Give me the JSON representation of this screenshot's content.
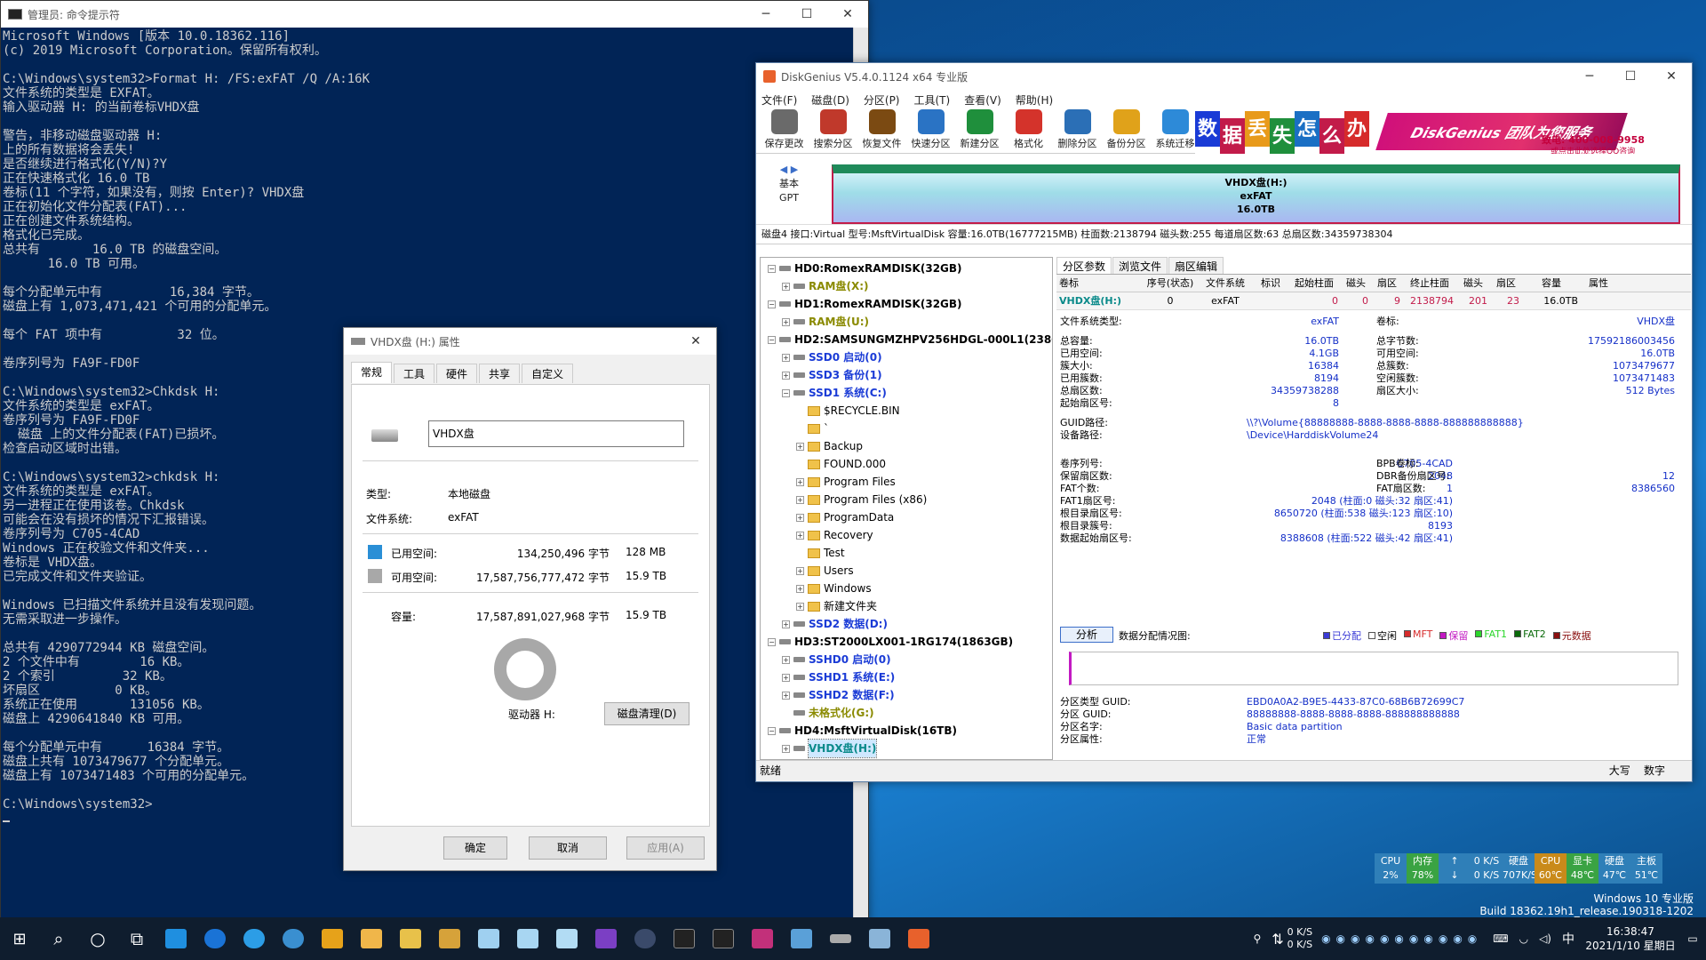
{
  "cmd": {
    "title": "管理员: 命令提示符",
    "lines": [
      "Microsoft Windows [版本 10.0.18362.116]",
      "(c) 2019 Microsoft Corporation。保留所有权利。",
      "",
      "C:\\Windows\\system32>Format H: /FS:exFAT /Q /A:16K",
      "文件系统的类型是 EXFAT。",
      "输入驱动器 H: 的当前卷标VHDX盘",
      "",
      "警告，非移动磁盘驱动器 H:",
      "上的所有数据将会丢失!",
      "是否继续进行格式化(Y/N)?Y",
      "正在快速格式化 16.0 TB",
      "卷标(11 个字符，如果没有，则按 Enter)? VHDX盘",
      "正在初始化文件分配表(FAT)...",
      "正在创建文件系统结构。",
      "格式化已完成。",
      "总共有       16.0 TB 的磁盘空间。",
      "      16.0 TB 可用。",
      "",
      "每个分配单元中有         16,384 字节。",
      "磁盘上有 1,073,471,421 个可用的分配单元。",
      "",
      "每个 FAT 项中有          32 位。",
      "",
      "卷序列号为 FA9F-FD0F",
      "",
      "C:\\Windows\\system32>Chkdsk H:",
      "文件系统的类型是 exFAT。",
      "卷序列号为 FA9F-FD0F",
      "  磁盘 上的文件分配表(FAT)已损坏。",
      "检查启动区域时出错。",
      "",
      "C:\\Windows\\system32>chkdsk H:",
      "文件系统的类型是 exFAT。",
      "另一进程正在使用该卷。Chkdsk",
      "可能会在没有损坏的情况下汇报错误。",
      "卷序列号为 C705-4CAD",
      "Windows 正在校验文件和文件夹...",
      "卷标是 VHDX盘。",
      "已完成文件和文件夹验证。",
      "",
      "Windows 已扫描文件系统并且没有发现问题。",
      "无需采取进一步操作。",
      "",
      "总共有 4290772944 KB 磁盘空间。",
      "2 个文件中有        16 KB。",
      "2 个索引         32 KB。",
      "坏扇区          0 KB。",
      "系统正在使用       131056 KB。",
      "磁盘上 4290641840 KB 可用。",
      "",
      "每个分配单元中有      16384 字节。",
      "磁盘上共有 1073479677 个分配单元。",
      "磁盘上有 1073471483 个可用的分配单元。",
      "",
      "C:\\Windows\\system32>"
    ]
  },
  "dg": {
    "title": "DiskGenius V5.4.0.1124 x64 专业版",
    "menu": [
      "文件(F)",
      "磁盘(D)",
      "分区(P)",
      "工具(T)",
      "查看(V)",
      "帮助(H)"
    ],
    "tools": [
      {
        "label": "保存更改",
        "color": "#6a6a6a"
      },
      {
        "label": "搜索分区",
        "color": "#c0392b"
      },
      {
        "label": "恢复文件",
        "color": "#7b4a12"
      },
      {
        "label": "快速分区",
        "color": "#2a73c4"
      },
      {
        "label": "新建分区",
        "color": "#1f8f3c"
      },
      {
        "label": "格式化",
        "color": "#d4332b"
      },
      {
        "label": "删除分区",
        "color": "#2b6fb6"
      },
      {
        "label": "备份分区",
        "color": "#e0a21a"
      },
      {
        "label": "系统迁移",
        "color": "#2d8ad8"
      }
    ],
    "ad": {
      "tiles": [
        "数",
        "据",
        "丢",
        "失",
        "怎",
        "么",
        "办"
      ],
      "slogan": "DiskGenius 团队为您服务",
      "phone": "致电: 400-008-9958",
      "qq": "或点击此处选择QQ咨询"
    },
    "diskmap": {
      "basic": "基本",
      "gpt": "GPT",
      "name": "VHDX盘(H:)",
      "fs": "exFAT",
      "size": "16.0TB"
    },
    "diskinfo": "磁盘4 接口:Virtual  型号:MsftVirtualDisk  容量:16.0TB(16777215MB)  柱面数:2138794  磁头数:255  每道扇区数:63  总扇区数:34359738304",
    "tree": [
      {
        "t": "HD0:RomexRAMDISK(32GB)",
        "lvl": 0,
        "box": "⊟",
        "cls": "bold",
        "icon": "dk"
      },
      {
        "t": "RAM盘(X:)",
        "lvl": 1,
        "box": "⊞",
        "cls": "olive",
        "icon": "dk"
      },
      {
        "t": "HD1:RomexRAMDISK(32GB)",
        "lvl": 0,
        "box": "⊟",
        "cls": "bold",
        "icon": "dk"
      },
      {
        "t": "RAM盘(U:)",
        "lvl": 1,
        "box": "⊞",
        "cls": "olive",
        "icon": "dk"
      },
      {
        "t": "HD2:SAMSUNGMZHPV256HDGL-000L1(238GB)",
        "lvl": 0,
        "box": "⊟",
        "cls": "bold",
        "icon": "dk"
      },
      {
        "t": "SSD0 启动(0)",
        "lvl": 1,
        "box": "⊞",
        "cls": "blue",
        "icon": "dk"
      },
      {
        "t": "SSD3 备份(1)",
        "lvl": 1,
        "box": "⊞",
        "cls": "blue",
        "icon": "dk"
      },
      {
        "t": "SSD1 系统(C:)",
        "lvl": 1,
        "box": "⊟",
        "cls": "blue",
        "icon": "dk"
      },
      {
        "t": "$RECYCLE.BIN",
        "lvl": 2,
        "box": "",
        "cls": "",
        "icon": "fd"
      },
      {
        "t": "`",
        "lvl": 2,
        "box": "",
        "cls": "",
        "icon": "fd"
      },
      {
        "t": "Backup",
        "lvl": 2,
        "box": "⊞",
        "cls": "",
        "icon": "fd"
      },
      {
        "t": "FOUND.000",
        "lvl": 2,
        "box": "",
        "cls": "",
        "icon": "fd"
      },
      {
        "t": "Program Files",
        "lvl": 2,
        "box": "⊞",
        "cls": "",
        "icon": "fd"
      },
      {
        "t": "Program Files (x86)",
        "lvl": 2,
        "box": "⊞",
        "cls": "",
        "icon": "fd"
      },
      {
        "t": "ProgramData",
        "lvl": 2,
        "box": "⊞",
        "cls": "",
        "icon": "fd"
      },
      {
        "t": "Recovery",
        "lvl": 2,
        "box": "⊞",
        "cls": "",
        "icon": "fd"
      },
      {
        "t": "Test",
        "lvl": 2,
        "box": "",
        "cls": "",
        "icon": "fd"
      },
      {
        "t": "Users",
        "lvl": 2,
        "box": "⊞",
        "cls": "",
        "icon": "fd"
      },
      {
        "t": "Windows",
        "lvl": 2,
        "box": "⊞",
        "cls": "",
        "icon": "fd"
      },
      {
        "t": "新建文件夹",
        "lvl": 2,
        "box": "⊞",
        "cls": "",
        "icon": "fd"
      },
      {
        "t": "SSD2 数据(D:)",
        "lvl": 1,
        "box": "⊞",
        "cls": "blue",
        "icon": "dk"
      },
      {
        "t": "HD3:ST2000LX001-1RG174(1863GB)",
        "lvl": 0,
        "box": "⊟",
        "cls": "bold",
        "icon": "dk"
      },
      {
        "t": "SSHD0 启动(0)",
        "lvl": 1,
        "box": "⊞",
        "cls": "blue",
        "icon": "dk"
      },
      {
        "t": "SSHD1 系统(E:)",
        "lvl": 1,
        "box": "⊞",
        "cls": "blue",
        "icon": "dk"
      },
      {
        "t": "SSHD2 数据(F:)",
        "lvl": 1,
        "box": "⊞",
        "cls": "blue",
        "icon": "dk"
      },
      {
        "t": "未格式化(G:)",
        "lvl": 1,
        "box": "",
        "cls": "olive",
        "icon": "dk"
      },
      {
        "t": "HD4:MsftVirtualDisk(16TB)",
        "lvl": 0,
        "box": "⊟",
        "cls": "bold",
        "icon": "dk"
      },
      {
        "t": "VHDX盘(H:)",
        "lvl": 1,
        "box": "⊞",
        "cls": "teal sel",
        "icon": "dk"
      }
    ],
    "tabs": [
      "分区参数",
      "浏览文件",
      "扇区编辑"
    ],
    "columns": [
      "卷标",
      "序号(状态)",
      "文件系统",
      "标识",
      "起始柱面",
      "磁头",
      "扇区",
      "终止柱面",
      "磁头",
      "扇区",
      "容量",
      "属性"
    ],
    "row": [
      "VHDX盘(H:)",
      "0",
      "exFAT",
      "",
      "0",
      "0",
      "9",
      "2138794",
      "201",
      "23",
      "16.0TB",
      ""
    ],
    "fs_type_label": "文件系统类型:",
    "fs_type_value": "exFAT",
    "volume_label_label": "卷标:",
    "volume_label_value": "VHDX盘",
    "left_kv": [
      [
        "总容量:",
        "16.0TB"
      ],
      [
        "已用空间:",
        "4.1GB"
      ],
      [
        "簇大小:",
        "16384"
      ],
      [
        "已用簇数:",
        "8194"
      ],
      [
        "总扇区数:",
        "34359738288"
      ],
      [
        "起始扇区号:",
        "8"
      ]
    ],
    "right_kv": [
      [
        "总字节数:",
        "17592186003456"
      ],
      [
        "可用空间:",
        "16.0TB"
      ],
      [
        "总簇数:",
        "1073479677"
      ],
      [
        "空闲簇数:",
        "1073471483"
      ],
      [
        "扇区大小:",
        "512 Bytes"
      ]
    ],
    "guid_path_label": "GUID路径:",
    "guid_path": "\\\\?\\Volume{88888888-8888-8888-8888-888888888888}",
    "device_path_label": "设备路径:",
    "device_path": "\\Device\\HarddiskVolume24",
    "left_kv2": [
      [
        "卷序列号:",
        "C705-4CAD"
      ],
      [
        "保留扇区数:",
        "2048"
      ],
      [
        "FAT个数:",
        "1"
      ],
      [
        "FAT1扇区号:",
        "2048 (柱面:0 磁头:32 扇区:41)"
      ],
      [
        "根目录扇区号:",
        "8650720 (柱面:538 磁头:123 扇区:10)"
      ],
      [
        "根目录簇号:",
        "8193"
      ],
      [
        "数据起始扇区号:",
        "8388608 (柱面:522 磁头:42 扇区:41)"
      ]
    ],
    "right_kv2": [
      [
        "BPB卷标:",
        ""
      ],
      [
        "DBR备份扇区号:",
        "12"
      ],
      [
        "FAT扇区数:",
        "8386560"
      ]
    ],
    "analyze_btn": "分析",
    "alloc_label": "数据分配情况图:",
    "legend": [
      {
        "t": "已分配",
        "c": "#3b3bd6"
      },
      {
        "t": "空闲",
        "c": "#ffffff"
      },
      {
        "t": "MFT",
        "c": "#d62b2b"
      },
      {
        "t": "保留",
        "c": "#c219c2"
      },
      {
        "t": "FAT1",
        "c": "#2bd62b"
      },
      {
        "t": "FAT2",
        "c": "#0a6a0a"
      },
      {
        "t": "元数据",
        "c": "#8a1010"
      }
    ],
    "part_kv": [
      [
        "分区类型 GUID:",
        "EBD0A0A2-B9E5-4433-87C0-68B6B72699C7"
      ],
      [
        "分区 GUID:",
        "88888888-8888-8888-8888-888888888888"
      ],
      [
        "分区名字:",
        "Basic data partition"
      ],
      [
        "分区属性:",
        "正常"
      ]
    ],
    "status_left": "就绪",
    "status_caps": "大写",
    "status_num": "数字"
  },
  "props": {
    "title": "VHDX盘 (H:) 属性",
    "tabs": [
      "常规",
      "工具",
      "硬件",
      "共享",
      "自定义"
    ],
    "name_value": "VHDX盘",
    "type_label": "类型:",
    "type_value": "本地磁盘",
    "fs_label": "文件系统:",
    "fs_value": "exFAT",
    "used_label": "已用空间:",
    "used_bytes": "134,250,496 字节",
    "used_size": "128 MB",
    "free_label": "可用空间:",
    "free_bytes": "17,587,756,777,472 字节",
    "free_size": "15.9 TB",
    "cap_label": "容量:",
    "cap_bytes": "17,587,891,027,968 字节",
    "cap_size": "15.9 TB",
    "drive_label": "驱动器 H:",
    "cleanup_btn": "磁盘清理(D)",
    "used_fraction": 7.6e-06,
    "ok": "确定",
    "cancel": "取消",
    "apply": "应用(A)",
    "used_color": "#2a8fd6",
    "free_color": "#a8a8a8"
  },
  "monitor": [
    {
      "a": "CPU",
      "b": "2%",
      "c": "#2f7fb8"
    },
    {
      "a": "内存",
      "b": "78%",
      "c": "#3aa343"
    },
    {
      "a": "↑",
      "b": "↓",
      "c": "#2f7fb8"
    },
    {
      "a": "0 K/S",
      "b": "0 K/S",
      "c": "#2f7fb8"
    },
    {
      "a": "硬盘",
      "b": "707K/S",
      "c": "#2f7fb8"
    },
    {
      "a": "CPU",
      "b": "60℃",
      "c": "#c98a1a"
    },
    {
      "a": "显卡",
      "b": "48℃",
      "c": "#3aa343"
    },
    {
      "a": "硬盘",
      "b": "47℃",
      "c": "#2f7fb8"
    },
    {
      "a": "主板",
      "b": "51℃",
      "c": "#2f7fb8"
    }
  ],
  "watermark": {
    "line1": "Windows 10 专业版",
    "line2": "Build 18362.19h1_release.190318-1202"
  },
  "taskbar": {
    "net_up": "0 K/S",
    "net_down": "0 K/S",
    "ime": "中",
    "time": "16:38:47",
    "date": "2021/1/10 星期日"
  }
}
